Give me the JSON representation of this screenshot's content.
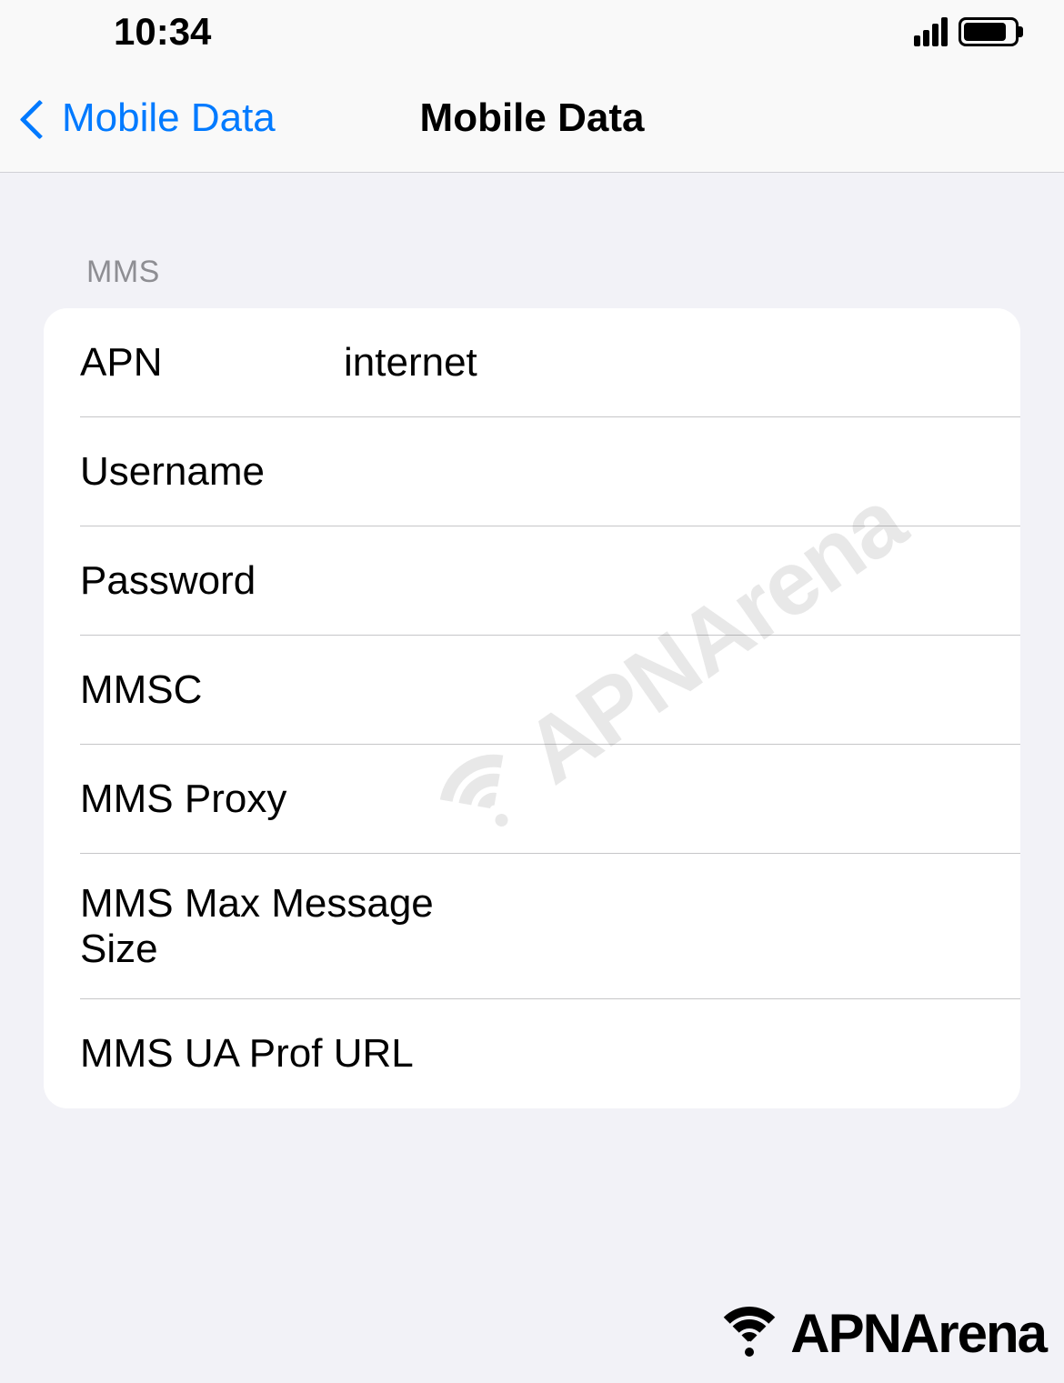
{
  "status_bar": {
    "time": "10:34"
  },
  "nav": {
    "back_label": "Mobile Data",
    "title": "Mobile Data"
  },
  "section": {
    "header": "MMS",
    "rows": [
      {
        "label": "APN",
        "value": "internet"
      },
      {
        "label": "Username",
        "value": ""
      },
      {
        "label": "Password",
        "value": ""
      },
      {
        "label": "MMSC",
        "value": ""
      },
      {
        "label": "MMS Proxy",
        "value": ""
      },
      {
        "label": "MMS Max Message Size",
        "value": ""
      },
      {
        "label": "MMS UA Prof URL",
        "value": ""
      }
    ]
  },
  "watermark": {
    "text": "APNArena"
  },
  "footer_logo": {
    "text": "APNArena"
  }
}
